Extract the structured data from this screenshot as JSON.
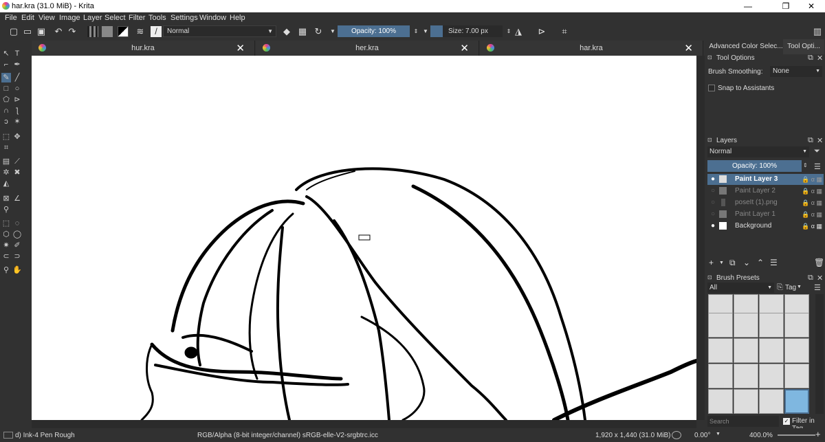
{
  "window": {
    "title": "har.kra (31.0 MiB)  - Krita",
    "minimize": "—",
    "maximize": "❐",
    "close": "✕"
  },
  "menu": [
    "File",
    "Edit",
    "View",
    "Image",
    "Layer",
    "Select",
    "Filter",
    "Tools",
    "Settings",
    "Window",
    "Help"
  ],
  "toolbar": {
    "blend_mode": "Normal",
    "opacity": "Opacity: 100%",
    "size": "Size: 7.00 px"
  },
  "tabs": [
    {
      "label": "hur.kra",
      "close": "✕"
    },
    {
      "label": "her.kra",
      "close": "✕"
    },
    {
      "label": "har.kra",
      "close": "✕"
    }
  ],
  "dock": {
    "tabs": [
      "Advanced Color Selec...",
      "Tool Opti..."
    ],
    "tool_options": {
      "title": "Tool Options",
      "brush_smoothing_label": "Brush Smoothing:",
      "brush_smoothing_value": "None",
      "snap_label": "Snap to Assistants"
    },
    "layers": {
      "title": "Layers",
      "blend_mode": "Normal",
      "opacity": "Opacity:  100%",
      "items": [
        {
          "name": "Paint Layer 3",
          "visible": true,
          "active": true
        },
        {
          "name": "Paint Layer 2",
          "visible": false,
          "active": false
        },
        {
          "name": "poseIt (1).png",
          "visible": false,
          "active": false
        },
        {
          "name": "Paint Layer 1",
          "visible": false,
          "active": false
        },
        {
          "name": "Background",
          "visible": true,
          "active": false
        }
      ]
    },
    "brush_presets": {
      "title": "Brush Presets",
      "filter": "All",
      "tag_label": "Tag",
      "search_placeholder": "Search",
      "filter_in_tag": "Filter in Tag"
    }
  },
  "status": {
    "brush": "d) Ink-4 Pen Rough",
    "color_profile": "RGB/Alpha (8-bit integer/channel)  sRGB-elle-V2-srgbtrc.icc",
    "dimensions": "1,920 x 1,440 (31.0 MiB)",
    "rotation": "0.00°",
    "zoom": "400.0%"
  },
  "colors": {
    "accent": "#4c6f91",
    "bg": "#313131",
    "canvas": "#ffffff"
  }
}
